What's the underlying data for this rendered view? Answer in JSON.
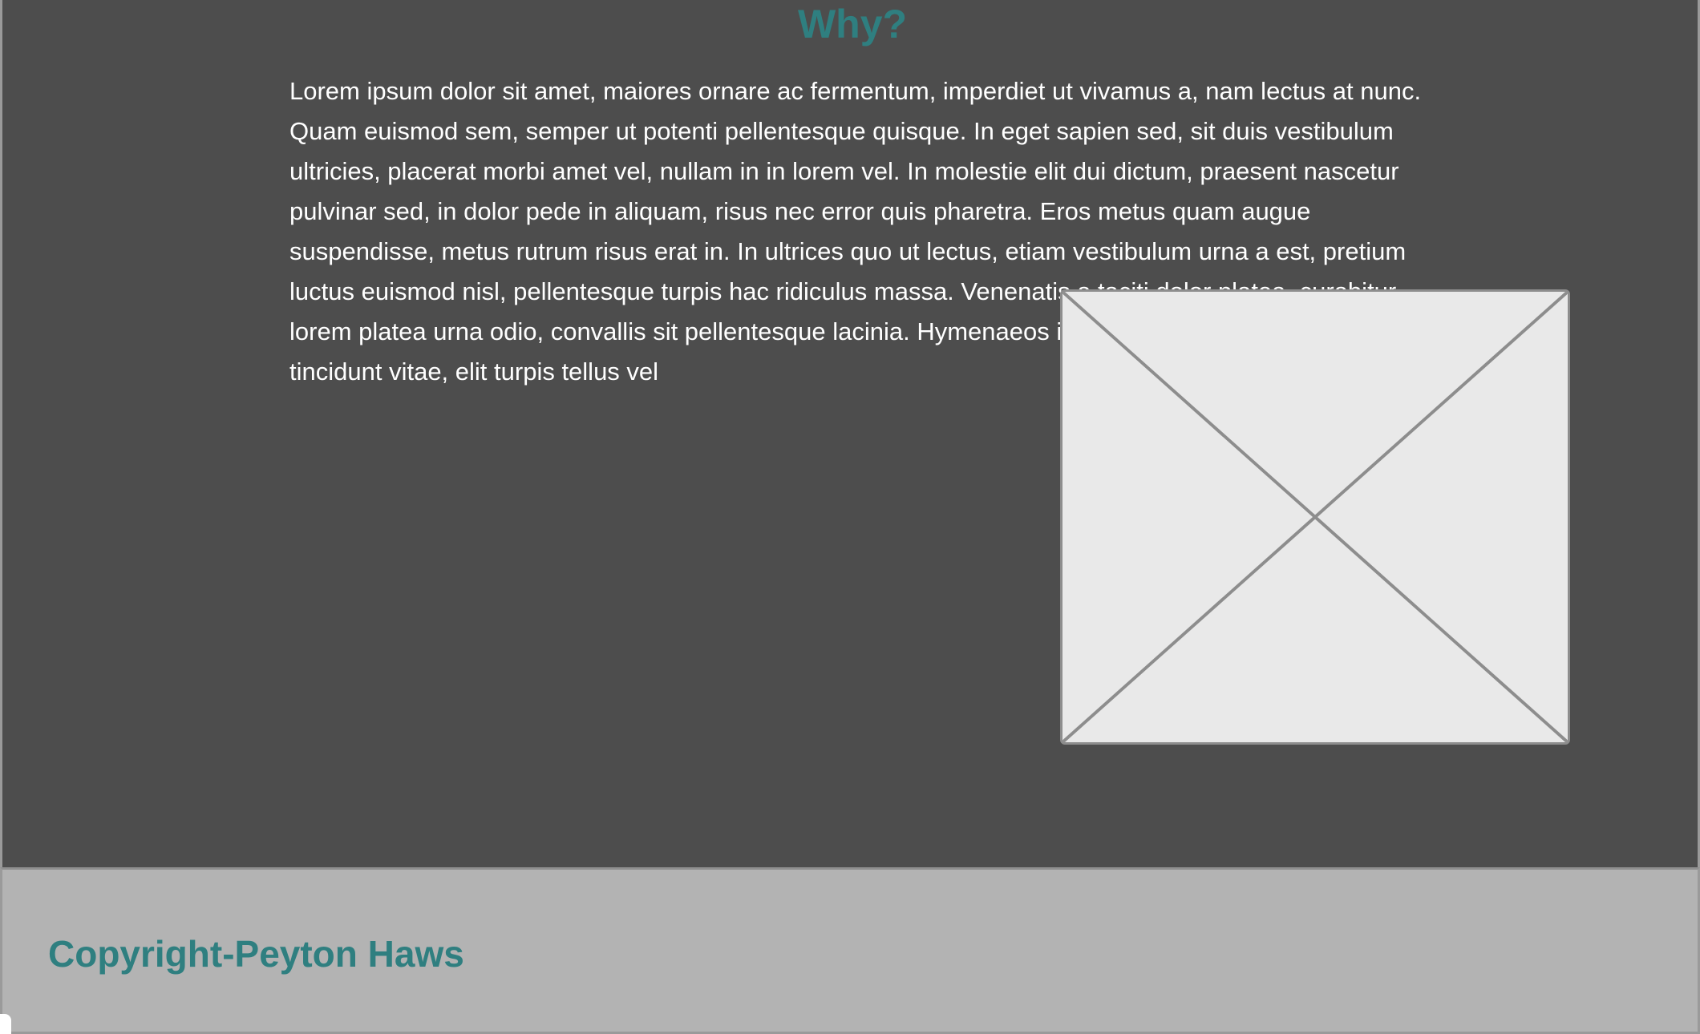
{
  "page": {
    "heading": "Why?",
    "body_text": "Lorem ipsum dolor sit amet, maiores ornare ac fermentum, imperdiet ut vivamus a, nam lectus at nunc. Quam euismod sem, semper ut potenti pellentesque quisque. In eget sapien sed, sit duis vestibulum ultricies, placerat morbi amet vel, nullam in in lorem vel. In molestie elit dui dictum, praesent nascetur pulvinar sed, in dolor pede in aliquam, risus nec error quis pharetra. Eros metus quam augue suspendisse, metus rutrum risus erat in.  In ultrices quo ut lectus, etiam vestibulum urna a est, pretium luctus euismod nisl, pellentesque turpis hac ridiculus massa. Venenatis a taciti dolor platea, curabitur lorem platea urna odio, convallis sit pellentesque lacinia. Hymenaeos ipsum velit diam nulla, fringilla vel tincidunt vitae, elit turpis tellus vel",
    "image_icon": "image-placeholder-icon"
  },
  "footer": {
    "copyright": "Copyright-Peyton Haws"
  },
  "colors": {
    "background": "#4d4d4d",
    "accent": "#2f7f80",
    "footer_background": "#b3b3b3",
    "placeholder_fill": "#e9e9e9",
    "placeholder_stroke": "#8d8d8d"
  }
}
